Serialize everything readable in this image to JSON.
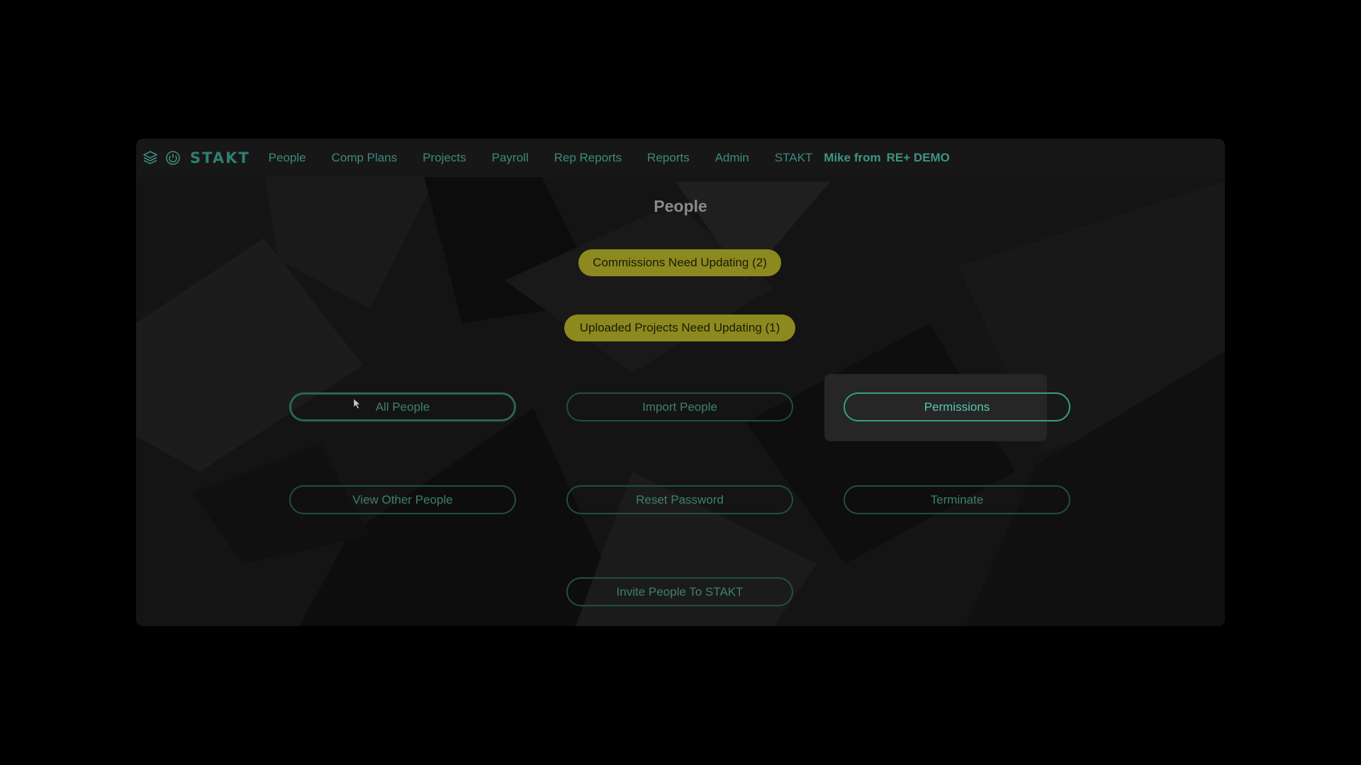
{
  "app": {
    "brand": "STAKT"
  },
  "nav": {
    "items": [
      "People",
      "Comp Plans",
      "Projects",
      "Payroll",
      "Rep Reports",
      "Reports",
      "Admin",
      "STAKT"
    ],
    "user": "Mike from",
    "org": "RE+ DEMO"
  },
  "page": {
    "title": "People"
  },
  "alerts": {
    "commissions": "Commissions Need Updating (2)",
    "uploaded": "Uploaded Projects Need Updating (1)"
  },
  "actions": {
    "all_people": "All People",
    "import_people": "Import People",
    "permissions": "Permissions",
    "view_other_people": "View Other People",
    "reset_password": "Reset Password",
    "terminate": "Terminate",
    "invite": "Invite People To STAKT"
  },
  "icons": {
    "stack": "stack-icon",
    "power": "power-icon",
    "cursor": "mouse-cursor-icon"
  },
  "colors": {
    "accent": "#3e8a7c",
    "alert": "#8c8a1e",
    "background": "#000000"
  }
}
